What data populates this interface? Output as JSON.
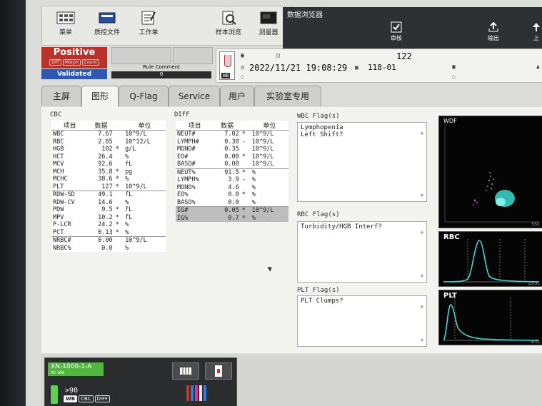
{
  "toolbar": {
    "buttons": [
      {
        "label": "菜单",
        "icon": "menu-icon"
      },
      {
        "label": "质控文件",
        "icon": "qc-file-icon"
      },
      {
        "label": "工作单",
        "icon": "worklist-icon"
      },
      {
        "label": "样本浏览",
        "icon": "sample-explorer-icon"
      },
      {
        "label": "测量器",
        "icon": "analyzer-icon"
      }
    ]
  },
  "window": {
    "title": "数据浏览器",
    "buttons": [
      {
        "label": "审核",
        "icon": "check-icon"
      },
      {
        "label": "输出",
        "icon": "export-icon"
      },
      {
        "label": "上",
        "icon": "arrow-up-icon"
      }
    ]
  },
  "status": {
    "positive": "Positive",
    "chips": [
      "Diff",
      "Morph",
      "Count"
    ],
    "validated": "Validated",
    "rule_comment_label": "Rule Comment",
    "rule_comment_value": "0"
  },
  "sample": {
    "tube_type": "WB",
    "sample_no": "122",
    "datetime": "2022/11/21 19:08:29",
    "rack_position": "118-01"
  },
  "tabs": [
    {
      "label": "主屏",
      "active": false
    },
    {
      "label": "图形",
      "active": true
    },
    {
      "label": "Q-Flag",
      "active": false
    },
    {
      "label": "Service",
      "active": false
    },
    {
      "label": "用户",
      "active": false
    },
    {
      "label": "实验室专用",
      "active": false
    }
  ],
  "cbc": {
    "title": "CBC",
    "headers": [
      "项目",
      "数据",
      "单位"
    ],
    "rows": [
      {
        "item": "WBC",
        "value": "7.67",
        "mark": "",
        "unit": "10^9/L",
        "sep": false
      },
      {
        "item": "RBC",
        "value": "2.85",
        "mark": "",
        "unit": "10^12/L",
        "sep": false
      },
      {
        "item": "HGB",
        "value": "102",
        "mark": "*",
        "unit": "g/L",
        "sep": false
      },
      {
        "item": "HCT",
        "value": "26.4",
        "mark": "",
        "unit": "%",
        "sep": false
      },
      {
        "item": "MCV",
        "value": "92.6",
        "mark": "",
        "unit": "fL",
        "sep": false
      },
      {
        "item": "MCH",
        "value": "35.8",
        "mark": "*",
        "unit": "pg",
        "sep": false
      },
      {
        "item": "MCHC",
        "value": "38.6",
        "mark": "*",
        "unit": "%",
        "sep": false
      },
      {
        "item": "PLT",
        "value": "127",
        "mark": "*",
        "unit": "10^9/L",
        "sep": false
      },
      {
        "item": "RDW-SD",
        "value": "49.1",
        "mark": "",
        "unit": "fL",
        "sep": true
      },
      {
        "item": "RDW-CV",
        "value": "14.6",
        "mark": "",
        "unit": "%",
        "sep": false
      },
      {
        "item": "PDW",
        "value": "9.5",
        "mark": "*",
        "unit": "fL",
        "sep": false
      },
      {
        "item": "MPV",
        "value": "10.2",
        "mark": "*",
        "unit": "fL",
        "sep": false
      },
      {
        "item": "P-LCR",
        "value": "24.2",
        "mark": "*",
        "unit": "%",
        "sep": false
      },
      {
        "item": "PCT",
        "value": "0.13",
        "mark": "*",
        "unit": "%",
        "sep": false
      },
      {
        "item": "NRBC#",
        "value": "0.00",
        "mark": "",
        "unit": "10^9/L",
        "sep": true
      },
      {
        "item": "NRBC%",
        "value": "0.0",
        "mark": "",
        "unit": "%",
        "sep": false
      }
    ]
  },
  "diff": {
    "title": "DIFF",
    "headers": [
      "项目",
      "数据",
      "单位"
    ],
    "rows": [
      {
        "item": "NEUT#",
        "value": "7.02",
        "mark": "*",
        "unit": "10^9/L",
        "sep": false,
        "hi": false
      },
      {
        "item": "LYMPH#",
        "value": "0.30",
        "mark": "-",
        "unit": "10^9/L",
        "sep": false,
        "hi": false
      },
      {
        "item": "MONO#",
        "value": "0.35",
        "mark": "",
        "unit": "10^9/L",
        "sep": false,
        "hi": false
      },
      {
        "item": "EO#",
        "value": "0.00",
        "mark": "*",
        "unit": "10^9/L",
        "sep": false,
        "hi": false
      },
      {
        "item": "BASO#",
        "value": "0.00",
        "mark": "",
        "unit": "10^9/L",
        "sep": false,
        "hi": false
      },
      {
        "item": "NEUT%",
        "value": "91.5",
        "mark": "*",
        "unit": "%",
        "sep": true,
        "hi": false
      },
      {
        "item": "LYMPH%",
        "value": "3.9",
        "mark": "-",
        "unit": "%",
        "sep": false,
        "hi": false
      },
      {
        "item": "MONO%",
        "value": "4.6",
        "mark": "",
        "unit": "%",
        "sep": false,
        "hi": false
      },
      {
        "item": "EO%",
        "value": "0.0",
        "mark": "*",
        "unit": "%",
        "sep": false,
        "hi": false
      },
      {
        "item": "BASO%",
        "value": "0.0",
        "mark": "",
        "unit": "%",
        "sep": false,
        "hi": false
      },
      {
        "item": "IG#",
        "value": "0.05",
        "mark": "*",
        "unit": "10^9/L",
        "sep": true,
        "hi": true
      },
      {
        "item": "IG%",
        "value": "0.7",
        "mark": "*",
        "unit": "%",
        "sep": false,
        "hi": true
      }
    ]
  },
  "flags": {
    "wbc_title": "WBC Flag(s)",
    "wbc_lines": [
      "Lymphopenia",
      "Left Shift?"
    ],
    "rbc_title": "RBC Flag(s)",
    "rbc_lines": [
      "Turbidity/HGB Interf?"
    ],
    "plt_title": "PLT Flag(s)",
    "plt_lines": [
      "PLT Clumps?"
    ]
  },
  "plots": {
    "wdf_label": "WDF",
    "wdf_axis": "SSC",
    "rbc_label": "RBC",
    "rbc_axis": "250fL",
    "plt_label": "PLT",
    "plt_axis": "40fL"
  },
  "analyzer": {
    "name": "XN-1000-1-A",
    "sub": "Xn  Ide",
    "count": ">90",
    "tags": [
      "WB",
      "CBC",
      "DIFF"
    ]
  },
  "colors": {
    "positive": "#b8322a",
    "validated": "#2f56b3",
    "analyzer_ok": "#55b542",
    "plot_bg": "#050505",
    "curve": "#46d3d3"
  }
}
